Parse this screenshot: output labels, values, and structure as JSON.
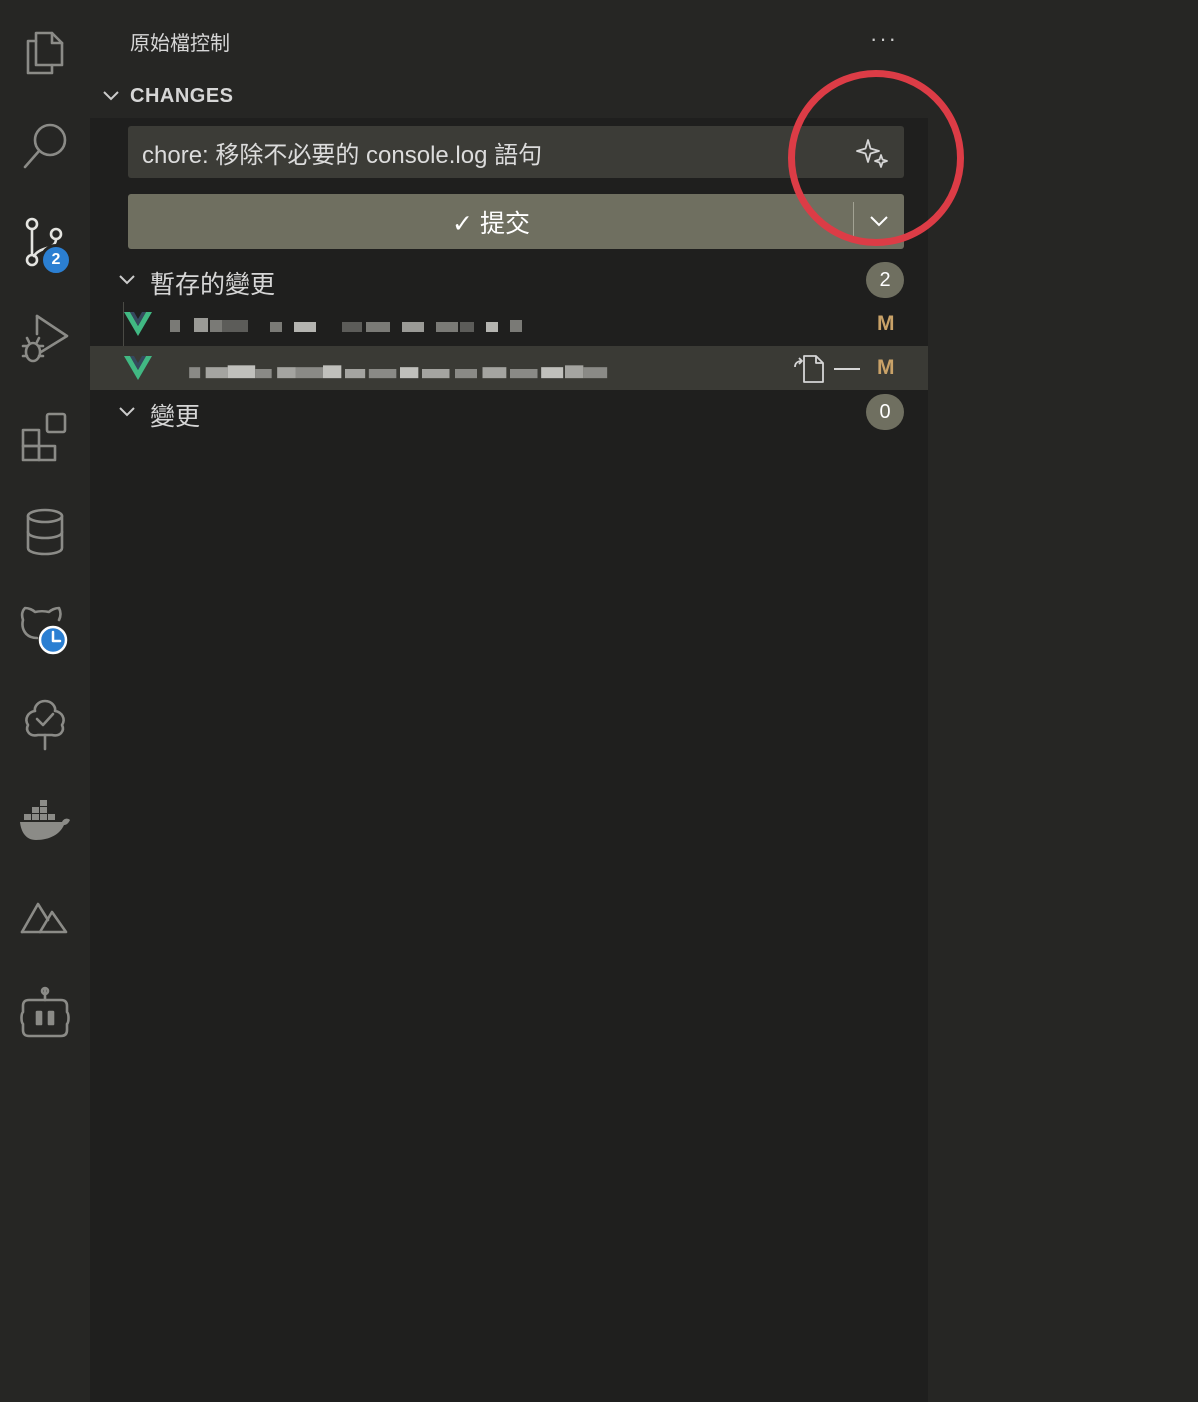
{
  "activity_bar": {
    "items": [
      {
        "name": "explorer",
        "icon": "files-icon"
      },
      {
        "name": "search",
        "icon": "search-icon"
      },
      {
        "name": "source-control",
        "icon": "source-control-icon",
        "badge": "2",
        "active": true
      },
      {
        "name": "run-debug",
        "icon": "run-debug-icon"
      },
      {
        "name": "extensions",
        "icon": "extensions-icon"
      },
      {
        "name": "database",
        "icon": "database-icon"
      },
      {
        "name": "github-timeline",
        "icon": "github-clock-icon"
      },
      {
        "name": "tree-check",
        "icon": "tree-check-icon"
      },
      {
        "name": "docker",
        "icon": "docker-icon"
      },
      {
        "name": "nuxt",
        "icon": "mountain-icon"
      },
      {
        "name": "copilot",
        "icon": "robot-icon"
      }
    ]
  },
  "sidebar": {
    "title": "原始檔控制",
    "more_actions": "···",
    "section_title": "CHANGES",
    "commit_message": "chore: 移除不必要的 console.log 語句",
    "commit_button": "✓ 提交",
    "groups": [
      {
        "label": "暫存的變更",
        "count": "2"
      },
      {
        "label": "變更",
        "count": "0"
      }
    ],
    "staged_files": [
      {
        "status": "M",
        "icon": "vue-file-icon"
      },
      {
        "status": "M",
        "icon": "vue-file-icon"
      }
    ]
  },
  "colors": {
    "accent_badge": "#2b7fd2",
    "commit_button_bg": "#6f6f60",
    "modified_status": "#c9a268",
    "vue_green": "#41b883",
    "annotation_red": "#dc3c46"
  }
}
